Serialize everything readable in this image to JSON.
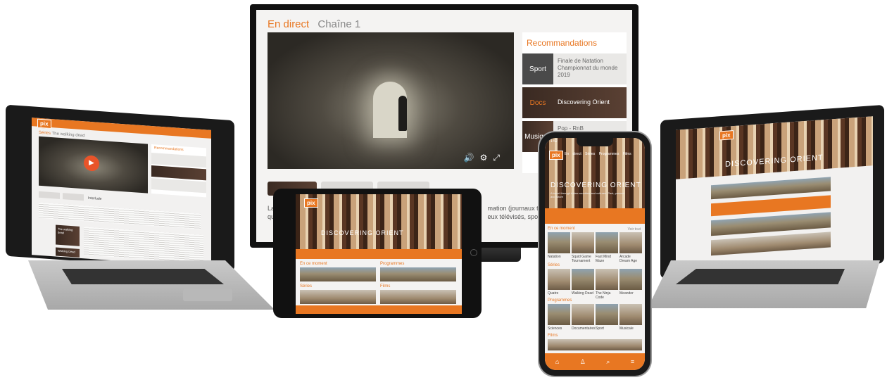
{
  "tv": {
    "live_label": "En direct",
    "channel": "Chaîne 1",
    "recommendations_title": "Recommandations",
    "recommendations": [
      {
        "category": "Sport",
        "text": "Finale de Natation Championnat du monde 2019"
      },
      {
        "category": "Docs",
        "text": "Discovering Orient"
      },
      {
        "category": "Musique",
        "text": "Pop - RnB"
      }
    ],
    "description_start": "La",
    "description_mid": "mation (journaux télévi",
    "description_2_start": "qu",
    "description_2_mid": "eux télévisés, sports)"
  },
  "left_laptop": {
    "logo": "pix",
    "title_prefix": "Séries",
    "title": "The walking dead",
    "recommendations_title": "Recommandations",
    "item_1": "The walking dead",
    "item_2": "Walking Dead",
    "tag": "Interlude"
  },
  "right_laptop": {
    "logo": "pix",
    "hero": "DISCOVERING ORIENT"
  },
  "tablet": {
    "logo": "pix",
    "hero": "DISCOVERING ORIENT",
    "section_1": "En ce moment",
    "section_2": "Programmes",
    "section_3": "Séries",
    "section_4": "Films"
  },
  "phone": {
    "logo": "pix",
    "time": "1:52",
    "nav": [
      "En direct",
      "Séries",
      "Programmes",
      "Films"
    ],
    "hero": "DISCOVERING ORIENT",
    "hero_sub": "A travel through Asian countries and cultures. Past, present and future",
    "sections": [
      {
        "title": "En ce moment",
        "items": [
          "Natation",
          "Squid Game Tournament",
          "Fast Mind Maze",
          "Arcade Dream Age"
        ]
      },
      {
        "title": "Séries",
        "items": [
          "Quatre",
          "Walking Dead",
          "The Ninja Code",
          "Meander"
        ]
      },
      {
        "title": "Programmes",
        "items": [
          "Sciences",
          "Documentaires",
          "Sport",
          "Musicale"
        ]
      },
      {
        "title": "Films",
        "items": []
      }
    ],
    "see_all": "Voir tout"
  },
  "colors": {
    "accent": "#e87722",
    "dark": "#1a1a1a"
  }
}
